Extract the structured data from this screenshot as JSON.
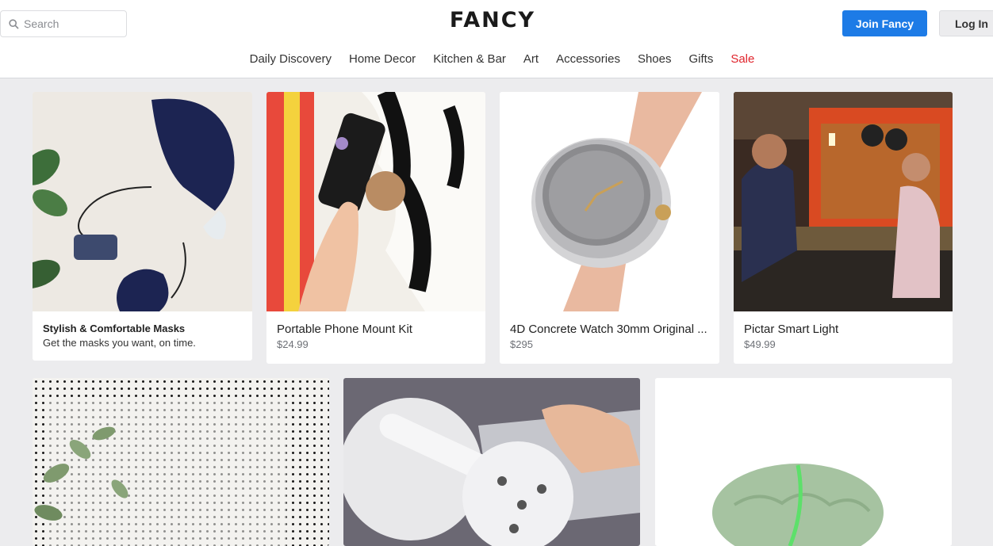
{
  "header": {
    "search_placeholder": "Search",
    "logo": "FANCY",
    "join_label": "Join Fancy",
    "login_label": "Log In"
  },
  "nav": {
    "items": [
      "Daily Discovery",
      "Home Decor",
      "Kitchen & Bar",
      "Art",
      "Accessories",
      "Shoes",
      "Gifts",
      "Sale"
    ]
  },
  "cards": [
    {
      "title": "Stylish & Comfortable Masks",
      "subtitle": "Get the masks you want, on time."
    },
    {
      "title": "Portable Phone Mount Kit",
      "price": "$24.99"
    },
    {
      "title": "4D Concrete Watch 30mm Original ...",
      "price": "$295"
    },
    {
      "title": "Pictar Smart Light",
      "price": "$49.99"
    }
  ],
  "colors": {
    "accent": "#1d7be6",
    "sale": "#e0242c",
    "page_bg": "#ececee"
  }
}
